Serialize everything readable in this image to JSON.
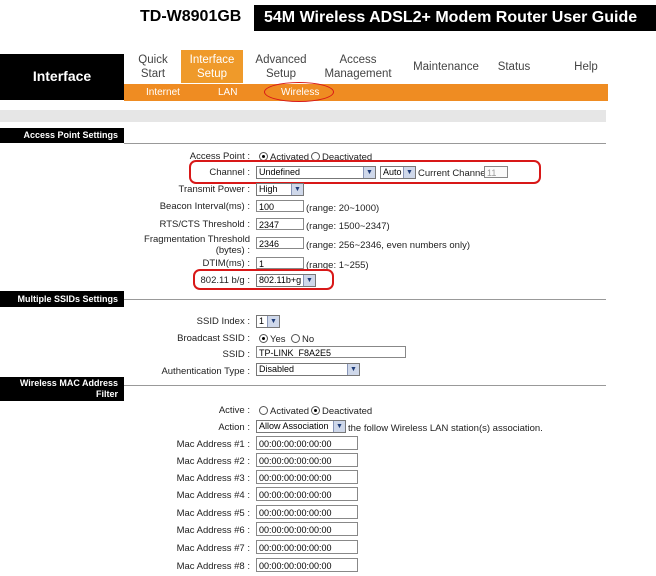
{
  "header": {
    "model": "TD-W8901GB",
    "title": "54M Wireless ADSL2+ Modem Router User Guide"
  },
  "nav": {
    "section": "Interface",
    "tabs": [
      {
        "label": "Quick\nStart"
      },
      {
        "label": "Interface\nSetup"
      },
      {
        "label": "Advanced\nSetup"
      },
      {
        "label": "Access\nManagement"
      },
      {
        "label": "Maintenance"
      },
      {
        "label": "Status"
      },
      {
        "label": "Help"
      }
    ],
    "subtabs": [
      "Internet",
      "LAN",
      "Wireless"
    ],
    "active_tab": "Interface Setup",
    "active_subtab": "Wireless"
  },
  "ap": {
    "section_title": "Access Point Settings",
    "access_point_label": "Access Point :",
    "activated": "Activated",
    "deactivated": "Deactivated",
    "channel_label": "Channel :",
    "channel_value": "Undefined",
    "auto_value": "Auto",
    "current_channel_label": "Current Channel:",
    "current_channel_value": "11",
    "transmit_power_label": "Transmit Power :",
    "transmit_power_value": "High",
    "beacon_label": "Beacon Interval(ms) :",
    "beacon_value": "100",
    "beacon_range": "(range: 20~1000)",
    "rts_label": "RTS/CTS Threshold :",
    "rts_value": "2347",
    "rts_range": "(range: 1500~2347)",
    "frag_label": "Fragmentation Threshold\n(bytes) :",
    "frag_value": "2346",
    "frag_range": "(range: 256~2346, even numbers only)",
    "dtim_label": "DTIM(ms) :",
    "dtim_value": "1",
    "dtim_range": "(range: 1~255)",
    "mode_label": "802.11 b/g :",
    "mode_value": "802.11b+g"
  },
  "ssid": {
    "section_title": "Multiple SSIDs Settings",
    "index_label": "SSID Index :",
    "index_value": "1",
    "broadcast_label": "Broadcast SSID :",
    "yes": "Yes",
    "no": "No",
    "ssid_label": "SSID :",
    "ssid_value": "TP-LINK_F8A2E5",
    "auth_label": "Authentication Type :",
    "auth_value": "Disabled"
  },
  "mac": {
    "section_title": "Wireless MAC Address\nFilter",
    "active_label": "Active :",
    "activated": "Activated",
    "deactivated": "Deactivated",
    "action_label": "Action :",
    "action_value": "Allow Association",
    "action_suffix": "the follow Wireless LAN station(s) association.",
    "addresses": [
      {
        "label": "Mac Address #1 :",
        "value": "00:00:00:00:00:00"
      },
      {
        "label": "Mac Address #2 :",
        "value": "00:00:00:00:00:00"
      },
      {
        "label": "Mac Address #3 :",
        "value": "00:00:00:00:00:00"
      },
      {
        "label": "Mac Address #4 :",
        "value": "00:00:00:00:00:00"
      },
      {
        "label": "Mac Address #5 :",
        "value": "00:00:00:00:00:00"
      },
      {
        "label": "Mac Address #6 :",
        "value": "00:00:00:00:00:00"
      },
      {
        "label": "Mac Address #7 :",
        "value": "00:00:00:00:00:00"
      },
      {
        "label": "Mac Address #8 :",
        "value": "00:00:00:00:00:00"
      }
    ]
  },
  "colors": {
    "nav_orange": "#ef8c22",
    "highlight_red": "#d81818",
    "header_black": "#000000"
  },
  "icons": {
    "dropdown": "chevron-down-icon",
    "radio": "radio-button"
  }
}
